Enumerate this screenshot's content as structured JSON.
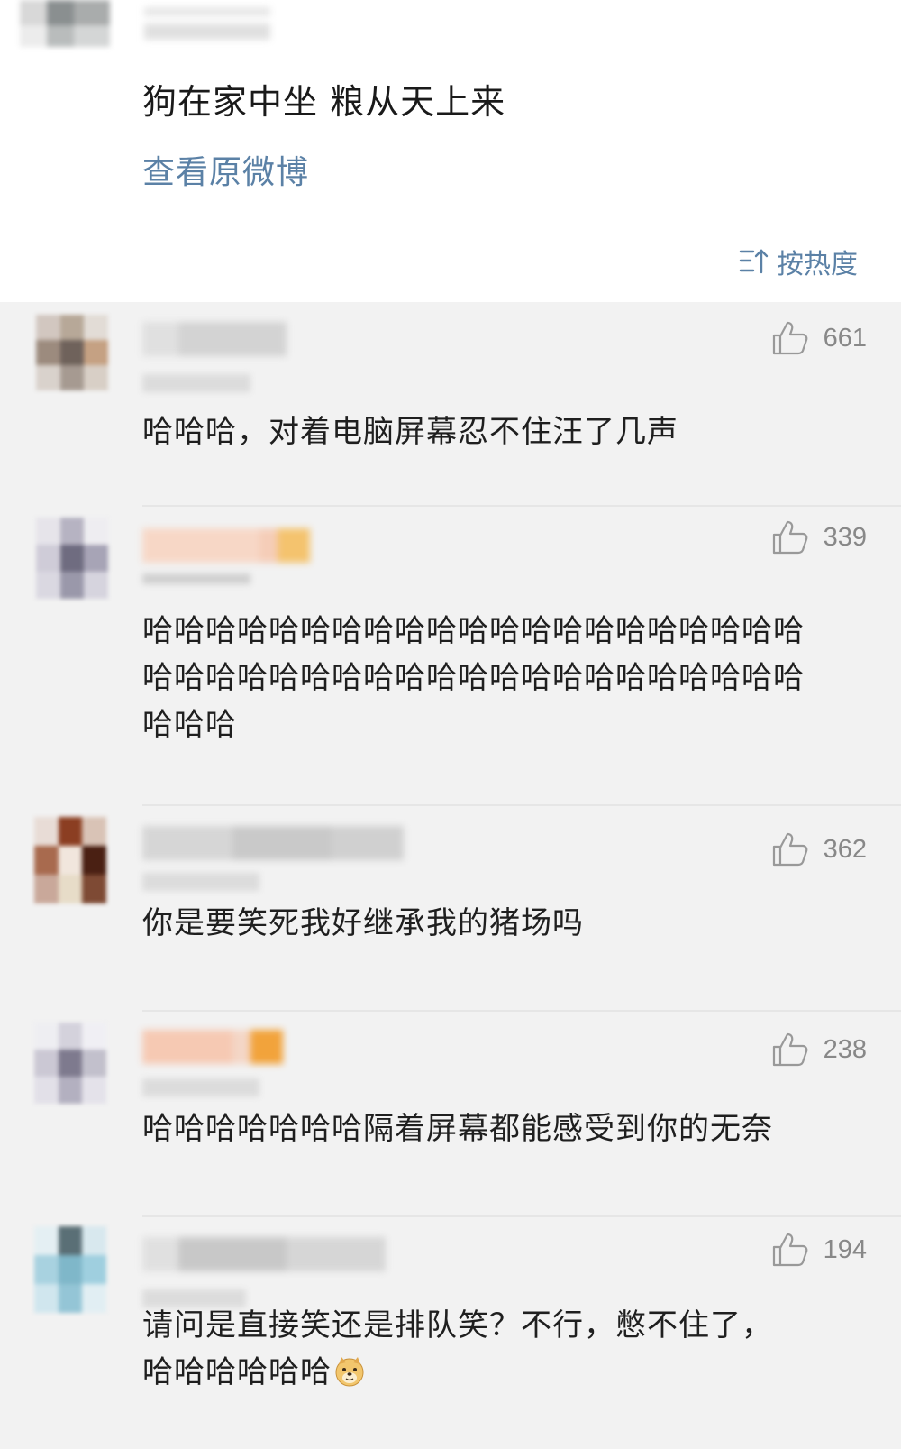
{
  "post": {
    "text": "狗在家中坐 粮从天上来",
    "view_original": "查看原微博",
    "sort_label": "按热度"
  },
  "comments": [
    {
      "likes": "661",
      "text": "哈哈哈，对着电脑屏幕忍不住汪了几声"
    },
    {
      "likes": "339",
      "text": "哈哈哈哈哈哈哈哈哈哈哈哈哈哈哈哈哈哈哈哈哈哈哈哈哈哈哈哈哈哈哈哈哈哈哈哈哈哈哈哈哈哈哈哈哈"
    },
    {
      "likes": "362",
      "text": "你是要笑死我好继承我的猪场吗"
    },
    {
      "likes": "238",
      "text": "哈哈哈哈哈哈哈隔着屏幕都能感受到你的无奈"
    },
    {
      "likes": "194",
      "text": "请问是直接笑还是排队笑？不行，憋不住了，",
      "text2": "哈哈哈哈哈哈",
      "emoji": "doge-emoji"
    }
  ],
  "colors": {
    "link": "#5b81a6",
    "background": "#f2f2f2",
    "count": "#888888"
  },
  "icons": {
    "like": "thumbs-up-outline-icon",
    "sort": "sort-hot-icon"
  }
}
